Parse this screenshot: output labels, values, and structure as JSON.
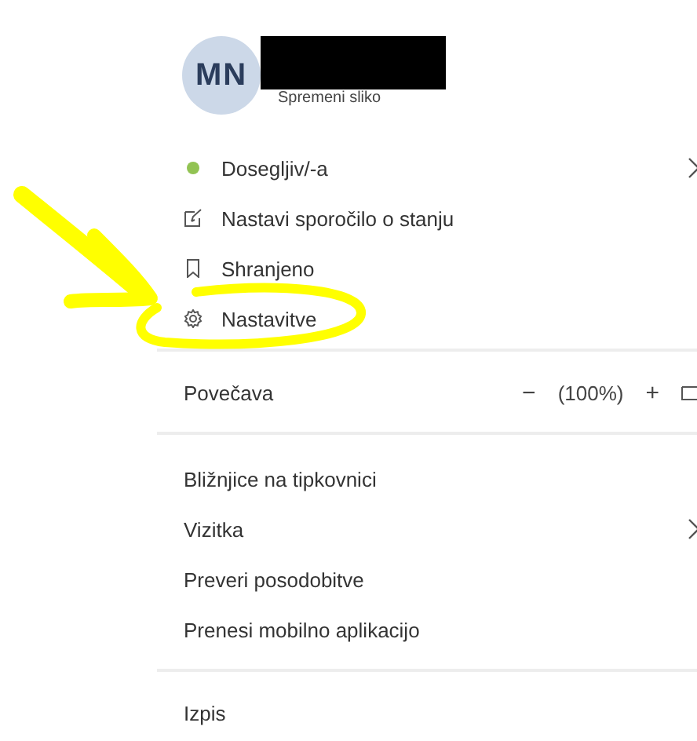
{
  "profile": {
    "initials": "MN",
    "change_photo": "Spremeni sliko"
  },
  "status_items": [
    {
      "kind": "status",
      "label": "Dosegljiv/-a",
      "color": "#92c353",
      "submenu": true
    },
    {
      "kind": "icon",
      "label": "Nastavi sporočilo o stanju",
      "submenu": false
    },
    {
      "kind": "icon",
      "label": "Shranjeno",
      "submenu": false
    },
    {
      "kind": "icon",
      "label": "Nastavitve",
      "submenu": false
    }
  ],
  "zoom": {
    "label": "Povečava",
    "minus": "−",
    "value": "(100%)",
    "plus": "+"
  },
  "menu_items": [
    {
      "label": "Bližnjice na tipkovnici",
      "submenu": false
    },
    {
      "label": "Vizitka",
      "submenu": true
    },
    {
      "label": "Preveri posodobitve",
      "submenu": false
    },
    {
      "label": "Prenesi mobilno aplikacijo",
      "submenu": false
    }
  ],
  "sign_out": "Izpis"
}
